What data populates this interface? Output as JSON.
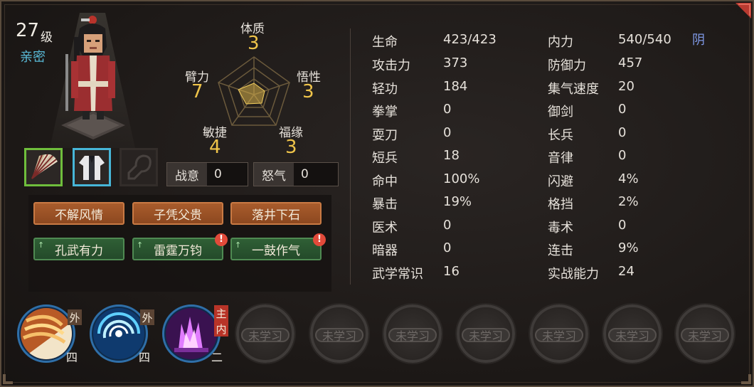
{
  "character": {
    "level": "27",
    "level_unit": "级",
    "relation": "亲密"
  },
  "attributes": {
    "tizhi": {
      "name": "体质",
      "value": "3"
    },
    "wuxing": {
      "name": "悟性",
      "value": "3"
    },
    "fuyuan": {
      "name": "福缘",
      "value": "3"
    },
    "minjie": {
      "name": "敏捷",
      "value": "4"
    },
    "bili": {
      "name": "臂力",
      "value": "7"
    }
  },
  "battle": {
    "zhanyi": {
      "label": "战意",
      "value": "0"
    },
    "nuqi": {
      "label": "怒气",
      "value": "0"
    }
  },
  "traits": {
    "negative": [
      "不解风情",
      "子凭父贵",
      "落井下石"
    ],
    "positive": [
      "孔武有力",
      "雷霆万钧",
      "一鼓作气"
    ],
    "warn_mark": "!"
  },
  "stats_left": [
    {
      "name": "生命",
      "value": "423/423"
    },
    {
      "name": "攻击力",
      "value": "373"
    },
    {
      "name": "轻功",
      "value": "184"
    },
    {
      "name": "拳掌",
      "value": "0"
    },
    {
      "name": "耍刀",
      "value": "0"
    },
    {
      "name": "短兵",
      "value": "18"
    },
    {
      "name": "命中",
      "value": "100%"
    },
    {
      "name": "暴击",
      "value": "19%"
    },
    {
      "name": "医术",
      "value": "0"
    },
    {
      "name": "暗器",
      "value": "0"
    },
    {
      "name": "武学常识",
      "value": "16"
    }
  ],
  "stats_right": [
    {
      "name": "内力",
      "value": "540/540"
    },
    {
      "name": "防御力",
      "value": "457"
    },
    {
      "name": "集气速度",
      "value": "20"
    },
    {
      "name": "御剑",
      "value": "0"
    },
    {
      "name": "长兵",
      "value": "0"
    },
    {
      "name": "音律",
      "value": "0"
    },
    {
      "name": "闪避",
      "value": "4%"
    },
    {
      "name": "格挡",
      "value": "2%"
    },
    {
      "name": "毒术",
      "value": "0"
    },
    {
      "name": "连击",
      "value": "9%"
    },
    {
      "name": "实战能力",
      "value": "24"
    }
  ],
  "yin_yang": "阴",
  "skills": [
    {
      "type": "外",
      "grade": "四",
      "icon": "fan-strike-icon"
    },
    {
      "type": "外",
      "grade": "四",
      "icon": "whirlwind-icon"
    },
    {
      "type_main": "主",
      "type": "内",
      "grade": "二",
      "icon": "purple-flame-icon"
    }
  ],
  "locked_label": "未学习",
  "colors": {
    "accent_gold": "#efc44a",
    "relation_blue": "#59b9d6",
    "yin_blue": "#7f99e6",
    "trait_negative": "#a95c2c",
    "trait_positive": "#2f5f35"
  }
}
